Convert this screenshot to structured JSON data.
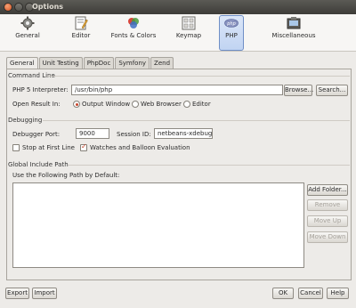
{
  "window": {
    "title": "Options"
  },
  "toolbar": {
    "categories": [
      {
        "label": "General",
        "icon": "gear-icon"
      },
      {
        "label": "Editor",
        "icon": "editor-icon"
      },
      {
        "label": "Fonts & Colors",
        "icon": "palette-icon"
      },
      {
        "label": "Keymap",
        "icon": "keyboard-icon"
      },
      {
        "label": "PHP",
        "icon": "php-icon",
        "selected": true
      },
      {
        "label": "Miscellaneous",
        "icon": "misc-icon"
      }
    ]
  },
  "tabs": [
    "General",
    "Unit Testing",
    "PhpDoc",
    "Symfony",
    "Zend"
  ],
  "command_line": {
    "section": "Command Line",
    "interpreter_label": "PHP 5 Interpreter:",
    "interpreter_value": "/usr/bin/php",
    "browse": "Browse...",
    "search": "Search...",
    "open_result_label": "Open Result In:",
    "options": [
      "Output Window",
      "Web Browser",
      "Editor"
    ],
    "selected_option": "Output Window"
  },
  "debugging": {
    "section": "Debugging",
    "port_label": "Debugger Port:",
    "port_value": "9000",
    "session_label": "Session ID:",
    "session_value": "netbeans-xdebug",
    "stop_first_line": "Stop at First Line",
    "stop_first_line_checked": false,
    "watches": "Watches and Balloon Evaluation",
    "watches_checked": true
  },
  "include_path": {
    "section": "Global Include Path",
    "label": "Use the Following Path by Default:",
    "add_folder": "Add Folder...",
    "remove": "Remove",
    "move_up": "Move Up",
    "move_down": "Move Down"
  },
  "footer": {
    "export": "Export",
    "import": "Import",
    "ok": "OK",
    "cancel": "Cancel",
    "help": "Help"
  },
  "colors": {
    "accent": "#6f8fc6",
    "check": "#c7442a",
    "titlebar": "#3d3c38"
  }
}
